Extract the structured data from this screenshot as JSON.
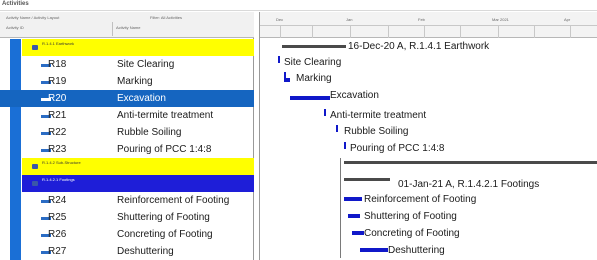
{
  "window": {
    "title": "Activities"
  },
  "columns": {
    "header_left": "Activity Name / Activity Layout",
    "header_right": "Filter: All Activities",
    "col_id": "Activity ID",
    "col_name": "Activity Name"
  },
  "timeline": {
    "labels": [
      "Dec",
      "Jan",
      "Feb",
      "Mar 2021",
      "Apr"
    ]
  },
  "rows": [
    {
      "type": "band",
      "color": "yellow",
      "label": "R.1.4.1 Earthwork"
    },
    {
      "type": "activity",
      "id": "R18",
      "name": "Site Clearing"
    },
    {
      "type": "activity",
      "id": "R19",
      "name": "Marking"
    },
    {
      "type": "activity",
      "id": "R20",
      "name": "Excavation",
      "selected": true
    },
    {
      "type": "activity",
      "id": "R21",
      "name": "Anti-termite treatment"
    },
    {
      "type": "activity",
      "id": "R22",
      "name": "Rubble Soiling"
    },
    {
      "type": "activity",
      "id": "R23",
      "name": "Pouring of PCC 1:4:8"
    },
    {
      "type": "band",
      "color": "yellow",
      "label": "R.1.4.2 Sub-Structure"
    },
    {
      "type": "band",
      "color": "blue",
      "label": "R.1.4.2.1 Footings"
    },
    {
      "type": "activity",
      "id": "R24",
      "name": "Reinforcement of Footing"
    },
    {
      "type": "activity",
      "id": "R25",
      "name": "Shuttering of Footing"
    },
    {
      "type": "activity",
      "id": "R26",
      "name": "Concreting of Footing"
    },
    {
      "type": "activity",
      "id": "R27",
      "name": "Deshuttering"
    }
  ],
  "gantt": {
    "summary1_label": "16-Dec-20 A, R.1.4.1  Earthwork",
    "summary2_label": "01-Jan-21 A, R.1.4.2.1  Footings",
    "tasks": [
      "Site Clearing",
      "Marking",
      "Excavation",
      "Anti-termite treatment",
      "Rubble Soiling",
      "Pouring of PCC 1:4:8",
      "Reinforcement of Footing",
      "Shuttering of Footing",
      "Concreting of Footing",
      "Deshuttering"
    ]
  },
  "colors": {
    "selected": "#1565c0",
    "wbs_yellow": "#ffff00",
    "wbs_blue": "#1e1ed8",
    "bar": "#1018c9",
    "tree": "#1a6fd6"
  }
}
